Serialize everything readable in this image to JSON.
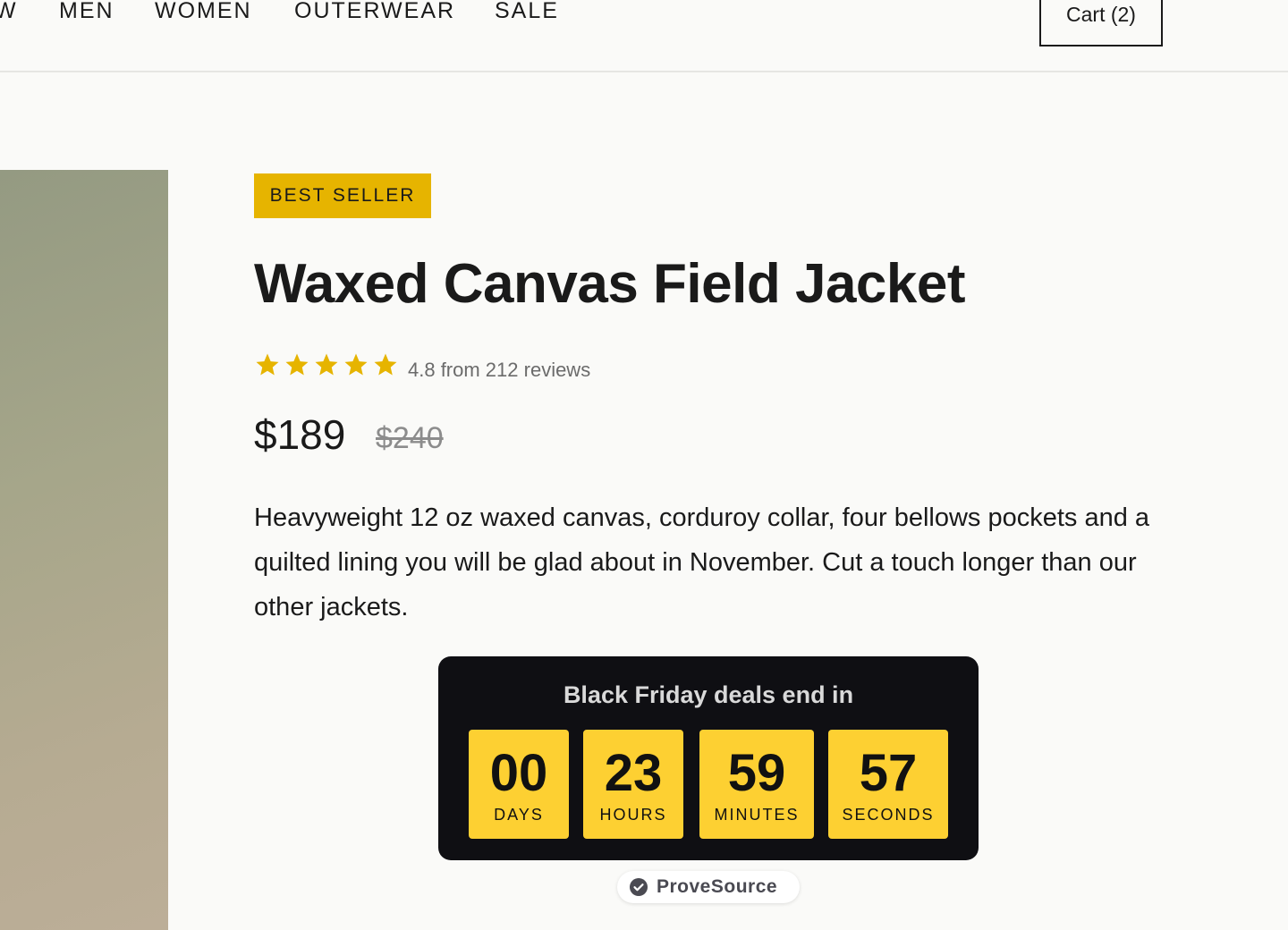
{
  "nav": {
    "items": [
      "W",
      "MEN",
      "WOMEN",
      "OUTERWEAR",
      "SALE"
    ],
    "cart_label": "Cart (2)"
  },
  "product": {
    "badge": "BEST SELLER",
    "title": "Waxed Canvas Field Jacket",
    "rating": 5,
    "rating_text": "4.8 from 212 reviews",
    "price": "$189",
    "old_price": "$240",
    "description": "Heavyweight 12 oz waxed canvas, corduroy collar, four bellows pockets and a quilted lining you will be glad about in November. Cut a touch longer than our other jackets."
  },
  "countdown": {
    "title": "Black Friday deals end in",
    "units": [
      {
        "value": "00",
        "label": "DAYS"
      },
      {
        "value": "23",
        "label": "HOURS"
      },
      {
        "value": "59",
        "label": "MINUTES"
      },
      {
        "value": "57",
        "label": "SECONDS"
      }
    ]
  },
  "provesource": {
    "label": "ProveSource",
    "icon": "check-circle-icon"
  },
  "colors": {
    "badge": "#e6b400",
    "star": "#e6b400",
    "countdown_bg": "#0f0f13",
    "countdown_box": "#fdd032"
  }
}
